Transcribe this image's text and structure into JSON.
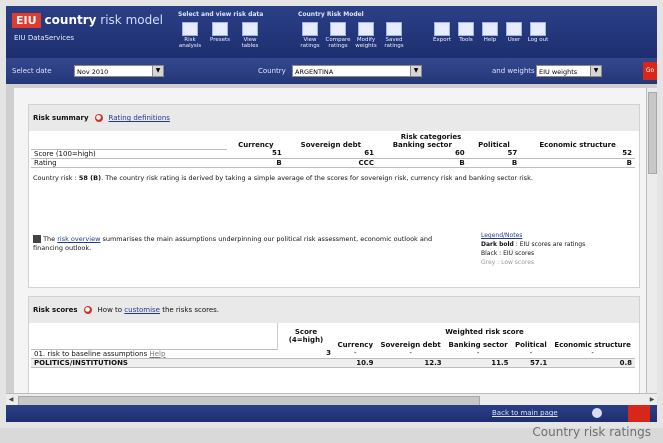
{
  "app": {
    "logo_abbrev": "EIU",
    "logo_name_bold": "country",
    "logo_name_light": " risk model",
    "logo_sub": "EIU DataServices"
  },
  "toolbar": {
    "group1_label": "Select and view risk data",
    "group2_label": "Country Risk Model",
    "buttons": [
      {
        "label": "Risk analysis",
        "icon": "risk-analysis-icon"
      },
      {
        "label": "Presets",
        "icon": "presets-icon"
      },
      {
        "label": "View tables",
        "icon": "view-tables-icon"
      },
      {
        "label": "View ratings",
        "icon": "view-ratings-icon"
      },
      {
        "label": "Compare ratings",
        "icon": "compare-ratings-icon"
      },
      {
        "label": "Modify weights",
        "icon": "modify-weights-icon"
      },
      {
        "label": "Saved ratings",
        "icon": "saved-ratings-icon"
      },
      {
        "label": "Export",
        "icon": "export-icon"
      },
      {
        "label": "Tools",
        "icon": "tools-icon"
      },
      {
        "label": "Help",
        "icon": "help-icon"
      },
      {
        "label": "User",
        "icon": "user-icon"
      },
      {
        "label": "Log out",
        "icon": "logout-icon"
      }
    ]
  },
  "selectors": {
    "date_label": "Select date",
    "date_value": "Nov 2010",
    "country_label": "Country",
    "country_value": "ARGENTINA",
    "weights_label": "and weights",
    "weights_value": "EIU weights"
  },
  "summary": {
    "title": "Risk summary",
    "definitions_link": "Rating definitions",
    "categories_header": "Risk categories",
    "columns": [
      "Currency",
      "Sovereign debt",
      "Banking sector",
      "Political",
      "Economic structure"
    ],
    "rows": [
      {
        "label": "Score (100=high)",
        "values": [
          "51",
          "61",
          "60",
          "57",
          "52"
        ]
      },
      {
        "label": "Rating",
        "values": [
          "B",
          "CCC",
          "B",
          "B",
          "B"
        ]
      }
    ],
    "country_risk_prefix": "Country risk : ",
    "country_risk_value": "58 (B)",
    "country_risk_text": ". The country risk rating is derived by taking a simple average of the scores for sovereign risk, currency risk and banking sector risk.",
    "note_prefix": "The ",
    "note_link": "risk overview",
    "note_text": " summarises the main assumptions underpinning our political risk assessment, economic outlook and financing outlook.",
    "legend_title": "Legend/Notes",
    "legend": [
      {
        "key": "Dark bold",
        "desc": "EIU scores are ratings"
      },
      {
        "key": "Black",
        "desc": "EIU scores"
      },
      {
        "key": "Grey",
        "desc": "Low scores"
      }
    ]
  },
  "scores": {
    "title": "Risk scores",
    "howto_prefix": "How to ",
    "howto_link": "customise",
    "howto_suffix": " the risks scores.",
    "score_header": "Score (4=high)",
    "weighted_header": "Weighted risk score",
    "columns": [
      "Currency",
      "Sovereign debt",
      "Banking sector",
      "Political",
      "Economic structure"
    ],
    "rows": [
      {
        "label": "01. risk to baseline assumptions",
        "link": "Help",
        "score": "3",
        "values": [
          "-",
          "-",
          "-",
          "-",
          "-"
        ],
        "bold": false
      },
      {
        "label": "POLITICS/INSTITUTIONS",
        "link": "",
        "score": "",
        "values": [
          "10.9",
          "12.3",
          "11.5",
          "57.1",
          "0.8"
        ],
        "bold": true
      }
    ]
  },
  "footer": {
    "back_link": "Back to main page"
  },
  "caption": "Country risk ratings"
}
